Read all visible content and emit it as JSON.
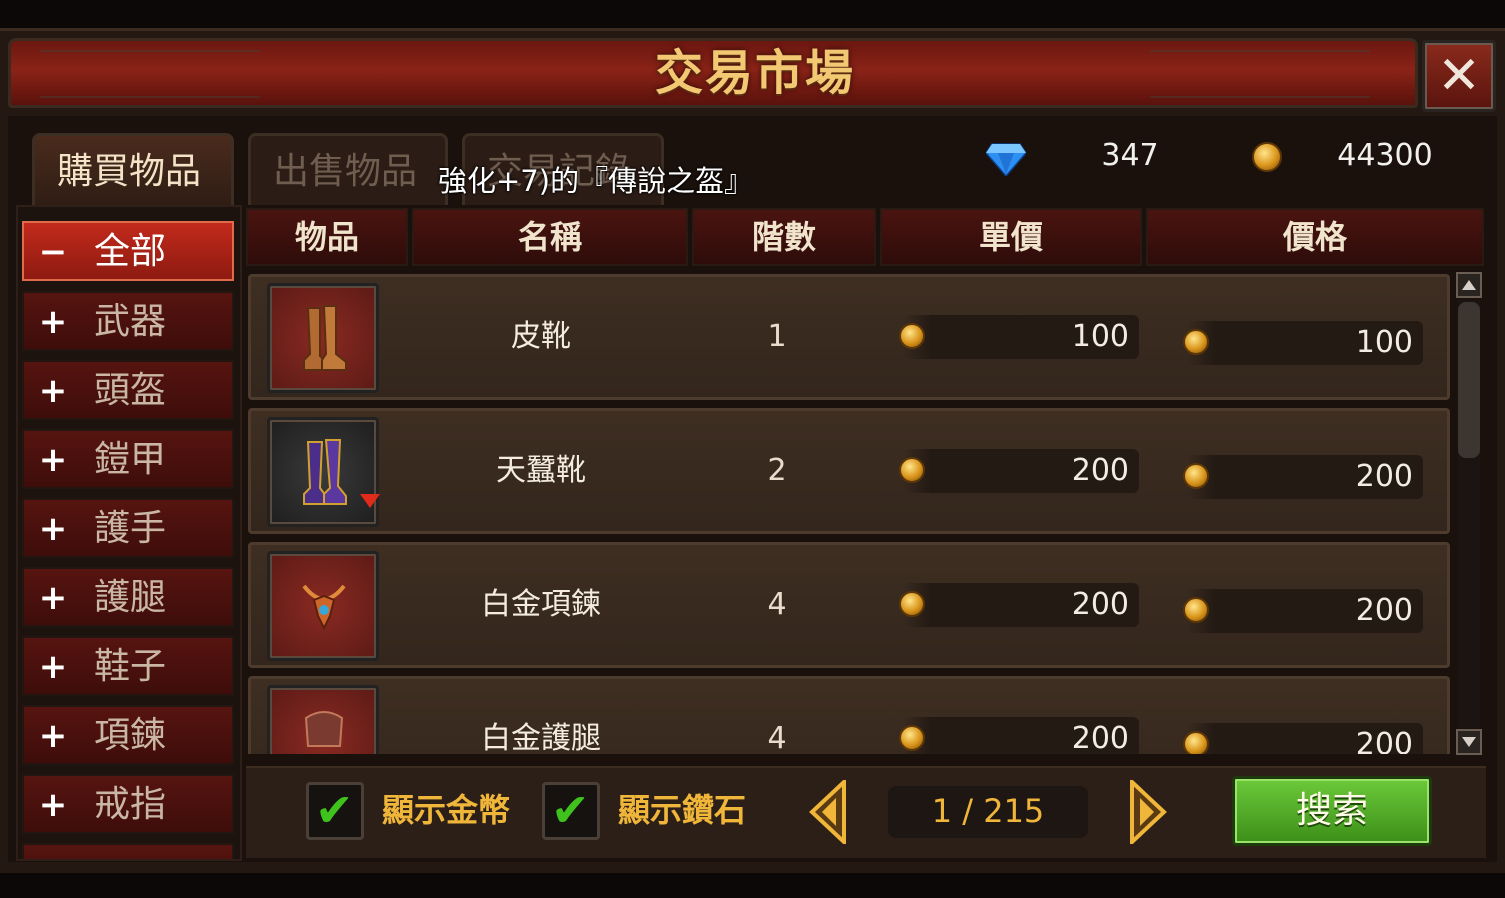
{
  "window": {
    "title": "交易市場"
  },
  "tabs": [
    {
      "label": "購買物品",
      "active": true
    },
    {
      "label": "出售物品",
      "active": false
    },
    {
      "label": "交易記錄",
      "active": false
    }
  ],
  "tooltip": "強化+7)的『傳說之盔』",
  "currency": {
    "diamonds": "347",
    "gold": "44300"
  },
  "categories": [
    {
      "symbol": "−",
      "label": "全部",
      "active": true
    },
    {
      "symbol": "+",
      "label": "武器"
    },
    {
      "symbol": "+",
      "label": "頭盔"
    },
    {
      "symbol": "+",
      "label": "鎧甲"
    },
    {
      "symbol": "+",
      "label": "護手"
    },
    {
      "symbol": "+",
      "label": "護腿"
    },
    {
      "symbol": "+",
      "label": "鞋子"
    },
    {
      "symbol": "+",
      "label": "項鍊"
    },
    {
      "symbol": "+",
      "label": "戒指"
    }
  ],
  "table": {
    "headers": {
      "item": "物品",
      "name": "名稱",
      "tier": "階數",
      "unit_price": "單價",
      "price": "價格"
    },
    "rows": [
      {
        "name": "皮靴",
        "tier": "1",
        "unit_price": "100",
        "price": "100"
      },
      {
        "name": "天蠶靴",
        "tier": "2",
        "unit_price": "200",
        "price": "200"
      },
      {
        "name": "白金項鍊",
        "tier": "4",
        "unit_price": "200",
        "price": "200"
      },
      {
        "name": "白金護腿",
        "tier": "4",
        "unit_price": "200",
        "price": "200"
      }
    ]
  },
  "filters": {
    "show_gold": "顯示金幣",
    "show_diamond": "顯示鑽石"
  },
  "pagination": {
    "label": "1 / 215"
  },
  "search_label": "搜索",
  "colors": {
    "accent_gold": "#f0b63a",
    "active_red": "#c22a1c",
    "search_green": "#4fae28"
  }
}
